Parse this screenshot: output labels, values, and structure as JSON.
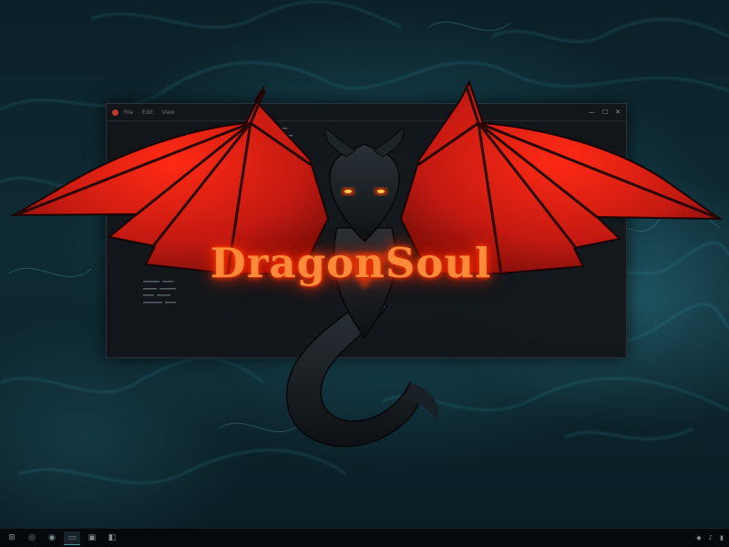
{
  "logo": {
    "text": "DragonSoul"
  },
  "colors": {
    "logo_glow": "#ff3b00",
    "dragon_red": "#c51a12",
    "smoke": "#2f8ea0"
  },
  "window": {
    "menu": [
      "File",
      "Edit",
      "View"
    ],
    "controls": {
      "minimize": "—",
      "maximize": "☐",
      "close": "✕"
    }
  },
  "icons": {
    "window_close_dot": "close-dot",
    "taskbar": [
      "start-icon",
      "search-icon",
      "browser-icon",
      "file-icon",
      "terminal-icon",
      "app-icon"
    ],
    "tray": [
      "network-icon",
      "volume-icon",
      "battery-icon"
    ]
  },
  "taskbar": {
    "icons": [
      "⊞",
      "◎",
      "◉",
      "▭",
      "▣",
      "◧"
    ],
    "tray_icons": [
      "◆",
      "♪",
      "▮"
    ]
  }
}
